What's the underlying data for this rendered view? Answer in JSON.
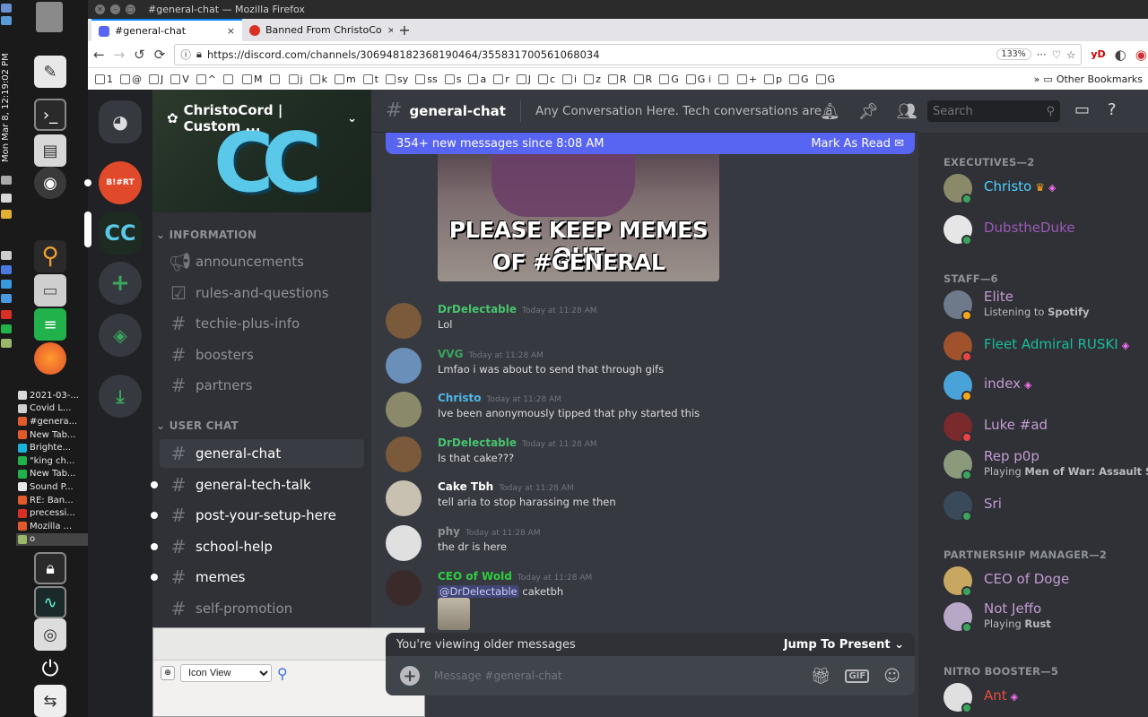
{
  "os": {
    "clock": "Mon Mar 8, 12:19:02 PM",
    "tasks": [
      {
        "label": "2021-03-...",
        "color": "#d8d8d8"
      },
      {
        "label": "Covid L...",
        "color": "#cfcfcf"
      },
      {
        "label": "#genera...",
        "color": "#e05a2b"
      },
      {
        "label": "New Tab...",
        "color": "#e05a2b"
      },
      {
        "label": "Brighte...",
        "color": "#17b3d9"
      },
      {
        "label": "\"king ch...",
        "color": "#22b24c"
      },
      {
        "label": "New Tab...",
        "color": "#22b24c"
      },
      {
        "label": "Sound P...",
        "color": "#e8e8e8"
      },
      {
        "label": "RE: Ban...",
        "color": "#e05a2b"
      },
      {
        "label": "precessi...",
        "color": "#d93025"
      },
      {
        "label": "Mozilla ...",
        "color": "#e05a2b"
      },
      {
        "label": "o",
        "color": "#9ab86a"
      }
    ]
  },
  "browser": {
    "window_title": "#general-chat — Mozilla Firefox",
    "tabs": [
      {
        "label": "#general-chat",
        "close": "×"
      },
      {
        "label": "Banned From ChristoCo",
        "close": "×"
      }
    ],
    "new_tab": "+",
    "url": "https://discord.com/channels/306948182368190464/355831700561068034",
    "zoom": "133%",
    "ext_yd": "yD",
    "bookmarks": [
      "1",
      "@",
      "J",
      "V",
      "^",
      "",
      "M",
      "",
      "j",
      "k",
      "m",
      "t",
      "sy",
      "ss",
      "s",
      "a",
      "r",
      "J",
      "c",
      "i",
      "z",
      "R",
      "R",
      "G",
      "G i",
      "",
      "+",
      "p",
      "G",
      "G"
    ],
    "other_bookmarks": "Other Bookmarks"
  },
  "discord": {
    "server_name": "ChristoCord | Custom ...",
    "banner_text": "CC",
    "guilds": {
      "bhrt": "B!#RT",
      "cc": "CC"
    },
    "categories": {
      "information": "INFORMATION",
      "user_chat": "USER CHAT"
    },
    "channels_info": [
      "announcements",
      "rules-and-questions",
      "techie-plus-info",
      "boosters",
      "partners"
    ],
    "channels_user": [
      "general-chat",
      "general-tech-talk",
      "post-your-setup-here",
      "school-help",
      "memes",
      "self-promotion"
    ],
    "header": {
      "channel": "general-chat",
      "topic": "Any Conversation Here. Tech conversations are all...",
      "search_placeholder": "Search"
    },
    "new_messages": {
      "text": "354+ new messages since 8:08 AM",
      "action": "Mark As Read"
    },
    "gif_caption": [
      "PLEASE KEEP MEMES OUT",
      "OF #GENERAL"
    ],
    "messages": [
      {
        "author": "DrDelectable",
        "color": "#46c46e",
        "time": "Today at 11:28 AM",
        "text": "Lol",
        "avatar": "#7a5a3a"
      },
      {
        "author": "VVG",
        "color": "#3ba55d",
        "time": "Today at 11:28 AM",
        "text": "Lmfao i was about to send that through gifs",
        "avatar": "#6a8fb8"
      },
      {
        "author": "Christo",
        "color": "#4fb8e8",
        "time": "Today at 11:28 AM",
        "text": "Ive been anonymously tipped that phy started this",
        "avatar": "#8a8a6a"
      },
      {
        "author": "DrDelectable",
        "color": "#46c46e",
        "time": "Today at 11:28 AM",
        "text": "Is that cake???",
        "avatar": "#7a5a3a"
      },
      {
        "author": "Cake Tbh",
        "color": "#ffffff",
        "time": "Today at 11:28 AM",
        "text": "tell aria to stop harassing me then",
        "avatar": "#c8c0b0"
      },
      {
        "author": "phy",
        "color": "#8e9297",
        "time": "Today at 11:28 AM",
        "text": "the dr is here",
        "avatar": "#e0e0e0"
      },
      {
        "author": "CEO of Wold",
        "color": "#2ecc40",
        "time": "Today at 11:28 AM",
        "mention": "@DrDelectable",
        "text": " caketbh",
        "avatar": "#3a2a2a"
      }
    ],
    "older": {
      "text": "You're viewing older messages",
      "action": "Jump To Present"
    },
    "composer_placeholder": "Message #general-chat",
    "composer_gif": "GIF",
    "member_groups": [
      {
        "title": "EXECUTIVES—2",
        "members": [
          {
            "name": "Christo",
            "color": "#4fd1ff",
            "crown": true,
            "boost": true,
            "status": "#3ba55d",
            "avatar": "#8a8a6a"
          },
          {
            "name": "DubstheDuke",
            "color": "#9b59b6",
            "status": "#3ba55d",
            "avatar": "#e6e6e6"
          }
        ]
      },
      {
        "title": "STAFF—6",
        "members": [
          {
            "name": "Elite",
            "color": "#c39bd3",
            "sub_pre": "Listening to ",
            "sub_bold": "Spotify",
            "status": "#faa61a",
            "avatar": "#6e7a8a"
          },
          {
            "name": "Fleet Admiral RUSKI",
            "color": "#1abc9c",
            "boost": true,
            "status": "#ed4245",
            "avatar": "#a0522d"
          },
          {
            "name": "index",
            "color": "#c39bd3",
            "boost": true,
            "status": "#faa61a",
            "avatar": "#4aa3d8"
          },
          {
            "name": "Luke #ad",
            "color": "#c39bd3",
            "status": "#ed4245",
            "avatar": "#7a2a2a"
          },
          {
            "name": "Rep p0p",
            "color": "#c39bd3",
            "sub_pre": "Playing ",
            "sub_bold": "Men of War: Assault S...",
            "status": "#3ba55d",
            "avatar": "#8a9a7a"
          },
          {
            "name": "Sri",
            "color": "#c39bd3",
            "status": "#3ba55d",
            "avatar": "#3a4a5a"
          }
        ]
      },
      {
        "title": "PARTNERSHIP MANAGER—2",
        "members": [
          {
            "name": "CEO of Doge",
            "color": "#c39bd3",
            "status": "#3ba55d",
            "avatar": "#c8a860"
          },
          {
            "name": "Not Jeffo",
            "color": "#c39bd3",
            "sub_pre": "Playing ",
            "sub_bold": "Rust",
            "status": "#3ba55d",
            "avatar": "#b8a8c8"
          }
        ]
      },
      {
        "title": "NITRO BOOSTER—5",
        "members": [
          {
            "name": "Ant",
            "color": "#e74c3c",
            "boost": true,
            "status": "#3ba55d",
            "avatar": "#e0e0e0"
          }
        ]
      }
    ]
  },
  "overlay_window": {
    "view_mode": "Icon View"
  }
}
